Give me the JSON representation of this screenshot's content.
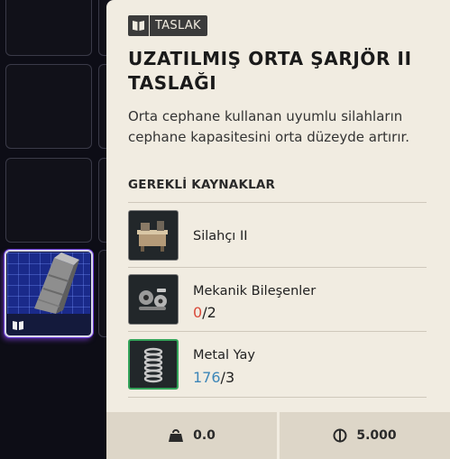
{
  "tooltip": {
    "tag_label": "TASLAK",
    "title": "UZATILMIŞ ORTA ŞARJÖR II TASLAĞI",
    "description": "Orta cephane kullanan uyumlu silahların cephane kapasitesini orta düzeyde artırır.",
    "requirements_heading": "GEREKLİ KAYNAKLAR",
    "requirements": [
      {
        "name": "Silahçı II",
        "icon": "workbench-icon"
      },
      {
        "name": "Mekanik Bileşenler",
        "have": "0",
        "need": "/2",
        "have_color": "#d94a3a",
        "icon": "mechanical-parts-icon"
      },
      {
        "name": "Metal Yay",
        "have": "176",
        "need": "/3",
        "have_color": "#3d86b8",
        "icon": "spring-icon"
      }
    ],
    "footer": {
      "weight": "0.0",
      "weight_icon": "weight-icon",
      "price": "5.000",
      "price_icon": "currency-icon"
    }
  },
  "inventory": {
    "selected_item_icon": "magazine-icon",
    "selected_badge_icon": "blueprint-book-icon"
  }
}
